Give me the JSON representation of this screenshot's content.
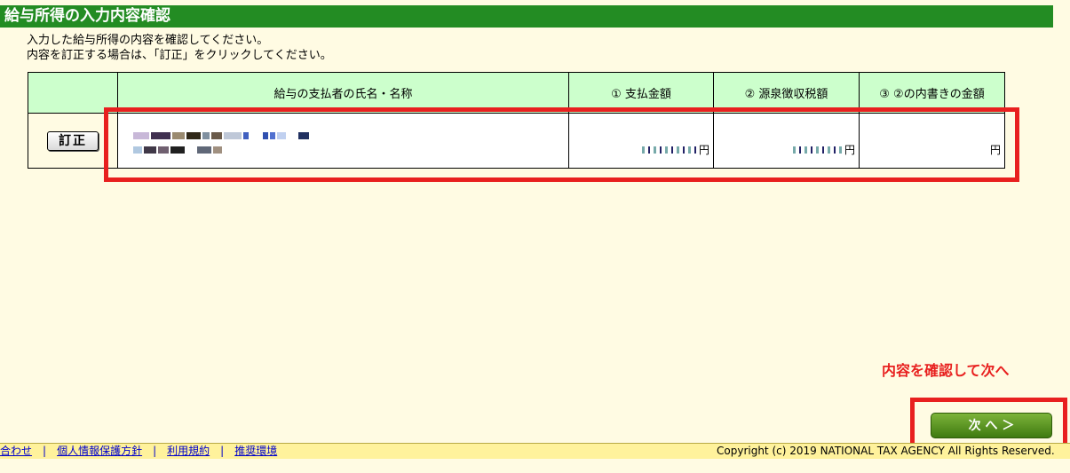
{
  "page": {
    "title": "給与所得の入力内容確認",
    "instructions": [
      "入力した給与所得の内容を確認してください。",
      "内容を訂正する場合は、「訂正」をクリックしてください。"
    ]
  },
  "table": {
    "headers": {
      "edit": "",
      "payer_name": "給与の支払者の氏名・名称",
      "payment_amount": "① 支払金額",
      "withholding_tax": "② 源泉徴収税額",
      "inner_amount": "③ ②の内書きの金額"
    },
    "rows": [
      {
        "edit_label": "訂正",
        "payer_name_line1": "",
        "payer_name_line2": "",
        "payment_amount_unit": "円",
        "withholding_tax_unit": "円",
        "inner_amount_unit": "円"
      }
    ]
  },
  "actions": {
    "hint": "内容を確認して次へ",
    "next_label": "次 へ ＞"
  },
  "footer": {
    "links": [
      "合わせ",
      "個人情報保護方針",
      "利用規約",
      "推奨環境"
    ],
    "separator": "|",
    "copyright": "Copyright (c) 2019 NATIONAL TAX AGENCY All Rights Reserved."
  },
  "colors": {
    "title_bar": "#238c23",
    "header_bg": "#ccffcc",
    "highlight_red": "#e8201f",
    "footer_bg": "#fff29c",
    "page_bg": "#fffbe3"
  }
}
